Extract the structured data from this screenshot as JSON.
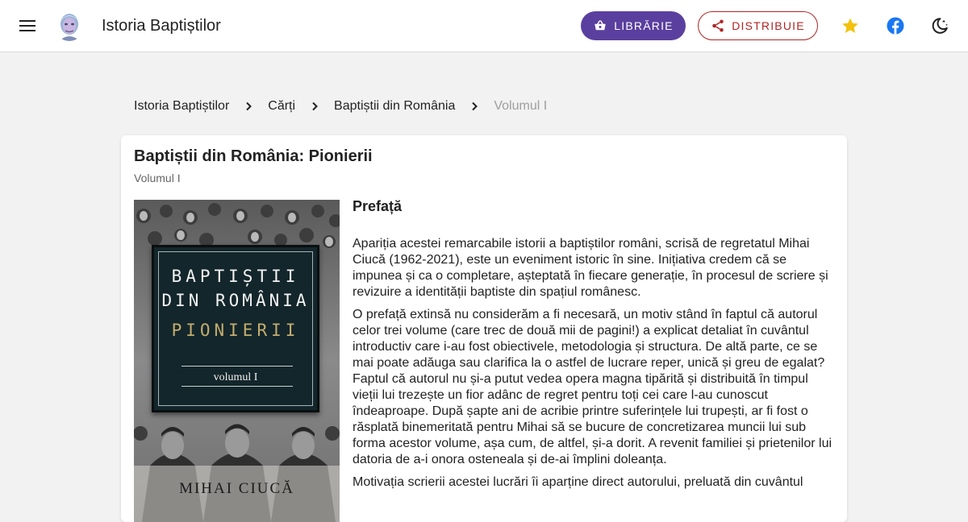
{
  "header": {
    "site_title": "Istoria Baptiștilor",
    "menu_icon": "hamburger-menu-icon",
    "avatar_icon": "author-portrait-avatar",
    "buttons": {
      "librarie": "LIBRĂRIE",
      "distribuie": "DISTRIBUIE"
    },
    "icons": [
      "shop-icon",
      "share-icon",
      "star-icon",
      "facebook-icon",
      "dark-mode-moon-icon"
    ],
    "colors": {
      "librarie_bg": "#5b3f9f",
      "distribuie_border": "#b02525",
      "star": "#f4c20d",
      "facebook": "#1877f2"
    }
  },
  "breadcrumb": [
    "Istoria Baptiștilor",
    "Cărți",
    "Baptiștii din România",
    "Volumul I"
  ],
  "book": {
    "title": "Baptiștii din România: Pionierii",
    "subtitle": "Volumul I",
    "cover": {
      "line1": "BAPTIȘTII",
      "line2": "DIN ROMÂNIA",
      "line3": "PIONIERII",
      "volume": "volumul I",
      "author": "MIHAI CIUCĂ"
    }
  },
  "content": {
    "heading": "Prefață",
    "paragraphs": [
      "Apariția acestei remarcabile istorii a baptiștilor români, scrisă de regretatul Mihai Ciucă (1962-2021), este un eveniment istoric în sine. Inițiativa credem că se impunea și ca o completare, așteptată în fiecare generație, în procesul de scriere și revizuire a identității baptiste din spațiul românesc.",
      "O prefață extinsă nu considerăm a fi necesară, un motiv stând în faptul că autorul celor trei volume (care trec de două mii de pagini!) a explicat detaliat în cuvântul introductiv care i-au fost obiectivele, metodologia și structura. De altă parte, ce se mai poate adăuga sau clarifica la o astfel de lucrare reper, unică și greu de egalat? Faptul că autorul nu și-a putut vedea opera magna tipărită și distribuită în timpul vieții lui trezește un fior adânc de regret pentru toți cei care l-au cunoscut îndeaproape. După șapte ani de acribie printre suferințele lui trupești, ar fi fost o răsplată binemeritată pentru Mihai să se bucure de concretizarea muncii lui sub forma acestor volume, așa cum, de altfel, și-a dorit. A revenit familiei și prietenilor lui datoria de a-i onora osteneala și de-ai împlini doleanța.",
      "Motivația scrierii acestei lucrări îi aparține direct autorului, preluată din cuvântul"
    ]
  }
}
